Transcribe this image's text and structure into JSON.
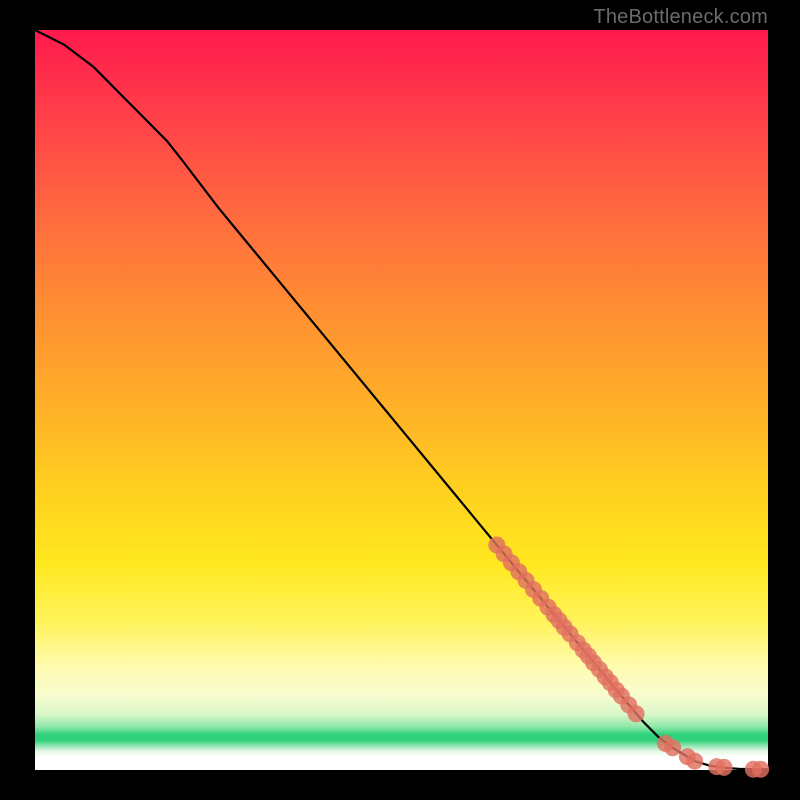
{
  "watermark": "TheBottleneck.com",
  "colors": {
    "dot": "#e07060",
    "curve": "#000000",
    "frame": "#000000"
  },
  "chart_data": {
    "type": "line",
    "title": "",
    "xlabel": "",
    "ylabel": "",
    "xlim": [
      0,
      100
    ],
    "ylim": [
      0,
      100
    ],
    "grid": false,
    "legend": false,
    "series": [
      {
        "name": "bottleneck-curve",
        "x": [
          0,
          2,
          4,
          6,
          8,
          10,
          12,
          14,
          16,
          18,
          20,
          25,
          30,
          35,
          40,
          45,
          50,
          55,
          60,
          65,
          70,
          75,
          80,
          83,
          85,
          87,
          89,
          90,
          92,
          94,
          96,
          98,
          100
        ],
        "y": [
          100,
          99,
          98,
          96.5,
          95,
          93,
          91,
          89,
          87,
          85,
          82.5,
          76,
          70,
          64,
          58,
          52,
          46,
          40,
          34,
          28,
          22,
          16,
          10,
          6.5,
          4.5,
          3,
          1.8,
          1.2,
          0.6,
          0.3,
          0.15,
          0.1,
          0.1
        ]
      }
    ],
    "highlight_points": {
      "name": "marked-points",
      "x": [
        63,
        64,
        65,
        66,
        67,
        68,
        69,
        70,
        70.8,
        71.5,
        72.2,
        73,
        74,
        74.8,
        75.5,
        76.2,
        77,
        77.8,
        78.5,
        79.3,
        80,
        81,
        82,
        86,
        87,
        89,
        90,
        93,
        94,
        98,
        99
      ],
      "y": [
        30.4,
        29.2,
        28,
        26.8,
        25.6,
        24.4,
        23.2,
        22,
        21,
        20.2,
        19.3,
        18.4,
        17.2,
        16.2,
        15.4,
        14.5,
        13.6,
        12.6,
        11.8,
        10.8,
        10,
        8.8,
        7.6,
        3.6,
        3,
        1.8,
        1.2,
        0.45,
        0.35,
        0.1,
        0.1
      ]
    }
  }
}
